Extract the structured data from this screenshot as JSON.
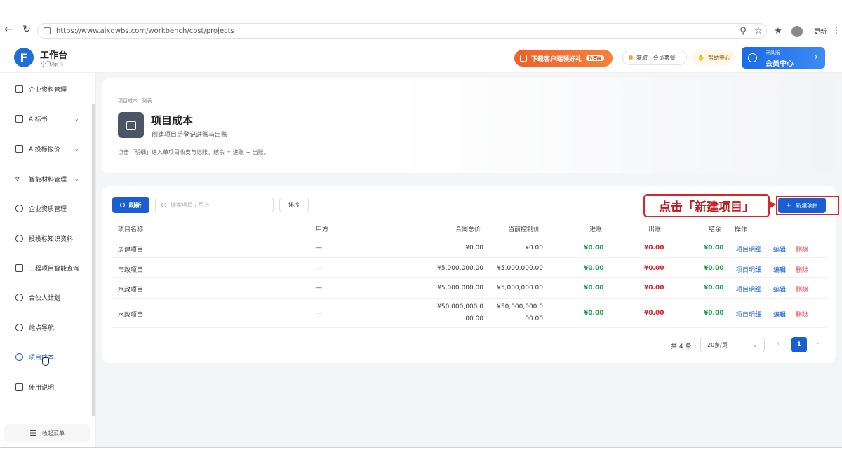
{
  "browser": {
    "url": "https://www.aixdwbs.com/workbench/cost/projects",
    "profile_label": "更新"
  },
  "header": {
    "app_title": "工作台",
    "app_subtitle": "小飞标书",
    "promo_label": "下载客户端领好礼",
    "promo_badge": "NEW",
    "member_label": "获取 · 会员套餐",
    "help_label": "帮助中心",
    "vip_small": "团队版",
    "vip_big": "会员中心"
  },
  "sidebar": {
    "items": [
      {
        "label": "企业资料管理",
        "has_chevron": false
      },
      {
        "label": "AI标书",
        "has_chevron": true
      },
      {
        "label": "AI投标报价",
        "has_chevron": true
      },
      {
        "label": "智能材料管理",
        "has_chevron": true
      },
      {
        "label": "企业资质管理",
        "has_chevron": false
      },
      {
        "label": "投投标知识资料",
        "has_chevron": false
      },
      {
        "label": "工程项目智能查询",
        "has_chevron": false
      },
      {
        "label": "合伙人计划",
        "has_chevron": false
      },
      {
        "label": "站点导航",
        "has_chevron": false
      },
      {
        "label": "项目成本",
        "has_chevron": false,
        "active": true
      },
      {
        "label": "使用说明",
        "has_chevron": false
      }
    ],
    "collapse_label": "收起菜单"
  },
  "hero": {
    "breadcrumb": "项目成本 · 列表",
    "title": "项目成本",
    "description": "创建项目后登记进账与出账",
    "tip": "点击「明细」进入单项目收支与记账。结余 = 进账 − 出账。"
  },
  "toolbar": {
    "refresh_label": "刷新",
    "search_placeholder": "搜索项目 / 甲方",
    "sort_label": "排序",
    "new_label": "新建项目"
  },
  "callout": {
    "text": "点击「新建项目」"
  },
  "table": {
    "headers": [
      "项目名称",
      "甲方",
      "合同总价",
      "当前控制价",
      "进账",
      "出账",
      "结余",
      "操作"
    ],
    "rows": [
      {
        "name": "房建项目",
        "party": "—",
        "contract": "¥0.00",
        "control": "¥0.00",
        "income": "¥0.00",
        "expense": "¥0.00",
        "balance": "¥0.00"
      },
      {
        "name": "市政项目",
        "party": "—",
        "contract": "¥5,000,000.00",
        "control": "¥5,000,000.00",
        "income": "¥0.00",
        "expense": "¥0.00",
        "balance": "¥0.00"
      },
      {
        "name": "水政项目",
        "party": "—",
        "contract": "¥5,000,000.00",
        "control": "¥5,000,000.00",
        "income": "¥0.00",
        "expense": "¥0.00",
        "balance": "¥0.00"
      },
      {
        "name": "水政项目",
        "party": "—",
        "contract_l1": "¥50,000,000.0",
        "contract_l2": "00.00",
        "control_l1": "¥50,000,000.0",
        "control_l2": "00.00",
        "income": "¥0.00",
        "expense": "¥0.00",
        "balance": "¥0.00"
      }
    ],
    "actions": {
      "detail": "项目明细",
      "edit": "编辑",
      "delete": "删除"
    }
  },
  "pagination": {
    "total": "共 4 条",
    "page_size": "20条/页",
    "current": "1"
  }
}
